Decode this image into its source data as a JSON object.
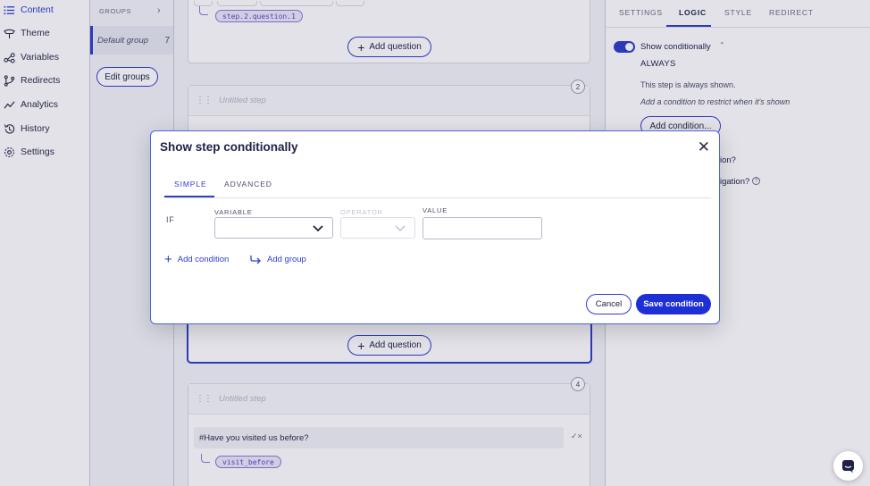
{
  "nav": {
    "items": [
      {
        "label": "Content",
        "icon": "list-icon"
      },
      {
        "label": "Theme",
        "icon": "brush-icon"
      },
      {
        "label": "Variables",
        "icon": "variables-icon"
      },
      {
        "label": "Redirects",
        "icon": "branch-icon"
      },
      {
        "label": "Analytics",
        "icon": "chart-line-icon"
      },
      {
        "label": "History",
        "icon": "history-icon"
      },
      {
        "label": "Settings",
        "icon": "gear-icon"
      }
    ]
  },
  "groups": {
    "header": "GROUPS",
    "items": [
      {
        "label": "Default group",
        "count": "7"
      }
    ],
    "edit_label": "Edit groups"
  },
  "canvas": {
    "step1_variable": "step.2.question.1",
    "add_question_label": "Add question",
    "step2": {
      "number": "2",
      "title_placeholder": "Untitled step"
    },
    "step4": {
      "number": "4",
      "title_placeholder": "Untitled step",
      "question": "#Have you visited us before?",
      "variable": "visit_before"
    }
  },
  "right_panel": {
    "tabs": [
      "SETTINGS",
      "LOGIC",
      "STYLE",
      "REDIRECT"
    ],
    "active_tab": "LOGIC",
    "toggle_label": "Show conditionally",
    "mode": "ALWAYS",
    "description": "This step is always shown.",
    "hint": "Add a condition to restrict when it's shown",
    "add_condition_label": "Add condition...",
    "partial_1": "ion?",
    "partial_2": "igation?"
  },
  "modal": {
    "title": "Show step conditionally",
    "tabs": [
      "SIMPLE",
      "ADVANCED"
    ],
    "active_tab": "SIMPLE",
    "if_label": "IF",
    "variable_label": "VARIABLE",
    "operator_label": "OPERATOR",
    "value_label": "VALUE",
    "variable_value": "",
    "operator_value": "",
    "value_value": "",
    "add_condition_label": "Add condition",
    "add_group_label": "Add group",
    "cancel_label": "Cancel",
    "save_label": "Save condition"
  },
  "colors": {
    "accent": "#2f3ec9",
    "save": "#1f2fd6",
    "tag": "#ece8fb"
  }
}
